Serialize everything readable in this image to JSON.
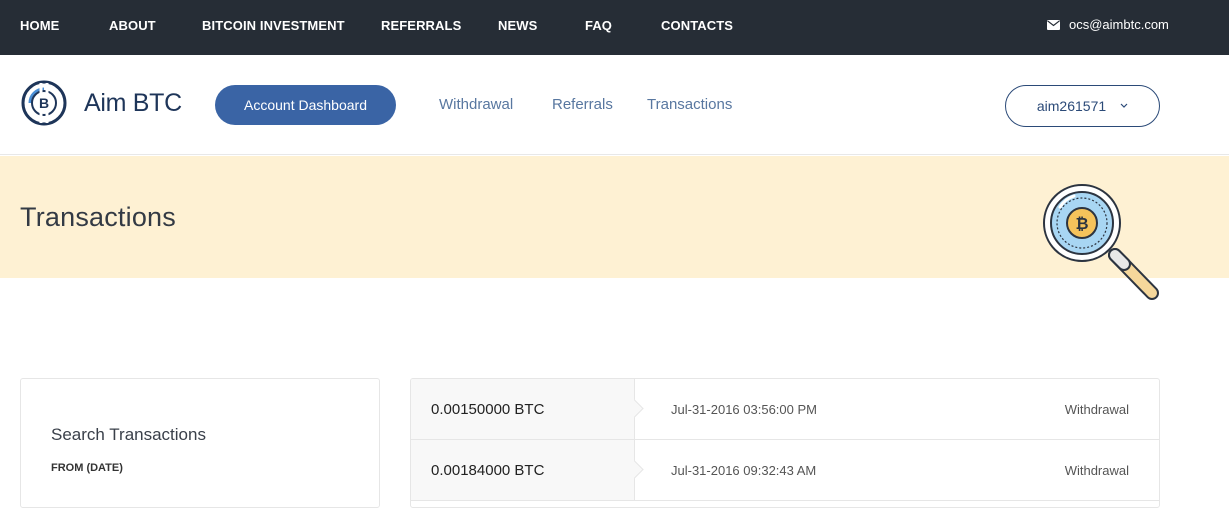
{
  "topnav": {
    "items": [
      "HOME",
      "ABOUT",
      "BITCOIN INVESTMENT",
      "REFERRALS",
      "NEWS",
      "FAQ",
      "CONTACTS"
    ],
    "email": "ocs@aimbtc.com"
  },
  "header": {
    "logo_text": "Aim BTC",
    "dashboard_button": "Account Dashboard",
    "nav": [
      "Withdrawal",
      "Referrals",
      "Transactions"
    ],
    "user": "aim261571"
  },
  "banner": {
    "title": "Transactions"
  },
  "search": {
    "title": "Search Transactions",
    "from_label": "FROM (DATE)"
  },
  "transactions": [
    {
      "amount": "0.00150000 BTC",
      "date": "Jul-31-2016 03:56:00 PM",
      "type": "Withdrawal"
    },
    {
      "amount": "0.00184000 BTC",
      "date": "Jul-31-2016 09:32:43 AM",
      "type": "Withdrawal"
    }
  ],
  "colors": {
    "topbar": "#262d36",
    "accent": "#3a64a5",
    "banner": "#fef1d3",
    "brand": "#1e3559"
  }
}
